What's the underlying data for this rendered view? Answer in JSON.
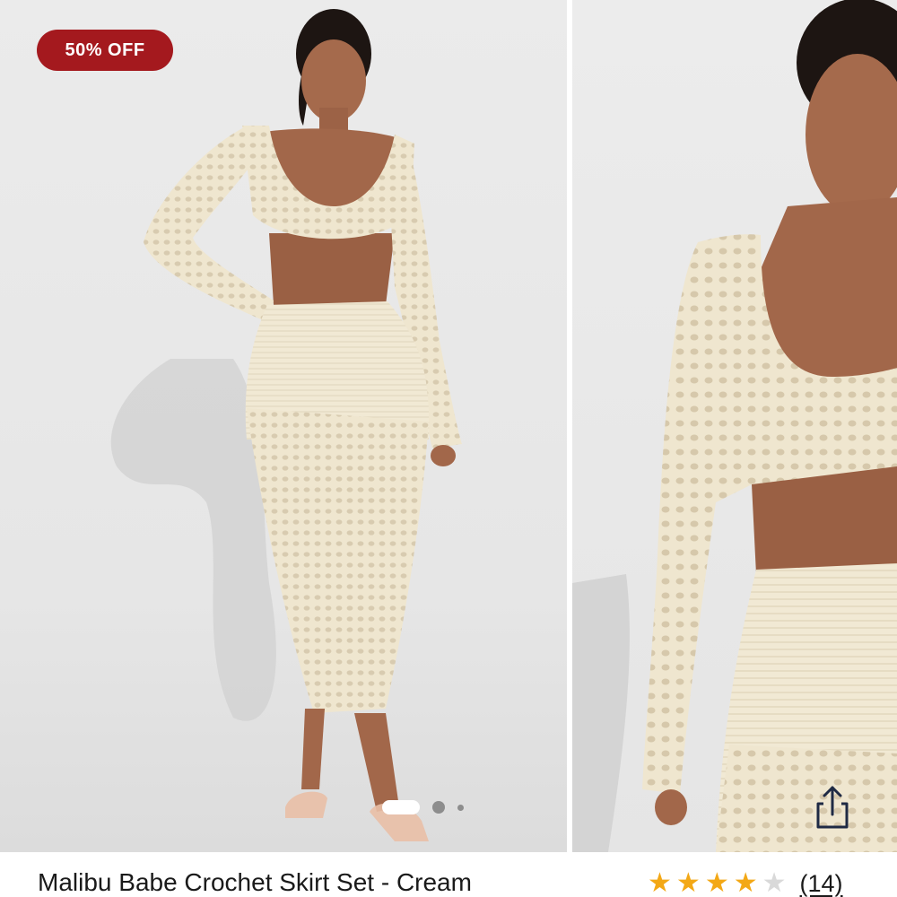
{
  "gallery": {
    "badge": "50% OFF",
    "slides": [
      {
        "name": "product-photo-full-length"
      },
      {
        "name": "product-photo-closeup"
      }
    ],
    "pager": {
      "count": 3,
      "active_index": 0
    }
  },
  "product": {
    "title": "Malibu Babe Crochet Skirt Set - Cream",
    "rating": {
      "value": 4,
      "max": 5,
      "stars": [
        "on",
        "on",
        "on",
        "on",
        "off"
      ]
    },
    "review_count": "(14)"
  },
  "icons": {
    "share": "share-icon",
    "star": "star-icon"
  },
  "colors": {
    "badge_bg": "#a4191e",
    "star_on": "#f3a816",
    "star_off": "#d9d9d9",
    "garment": "#efe6cf",
    "skin": "#a2674a"
  }
}
